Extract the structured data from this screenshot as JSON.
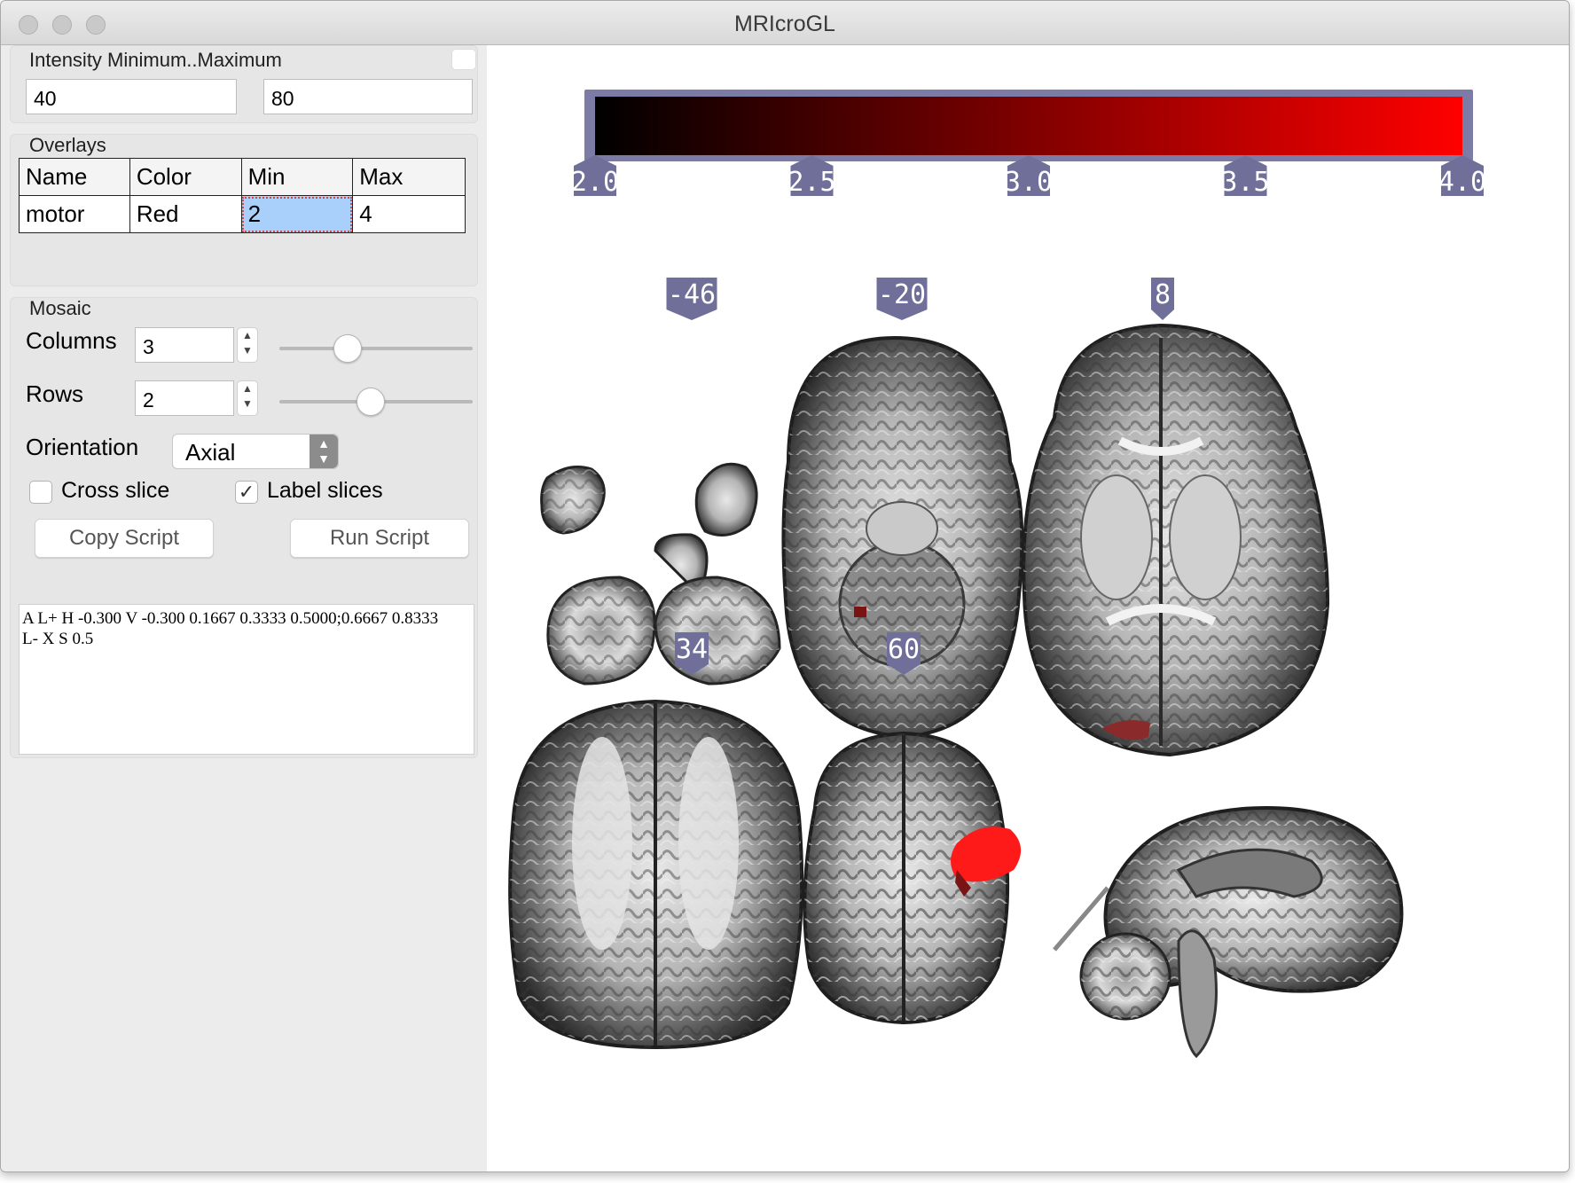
{
  "window": {
    "title": "MRIcroGL"
  },
  "intensity": {
    "label": "Intensity Minimum..Maximum",
    "min": "40",
    "max": "80"
  },
  "overlays": {
    "label": "Overlays",
    "headers": {
      "name": "Name",
      "color": "Color",
      "min": "Min",
      "max": "Max"
    },
    "row": {
      "name": "motor",
      "color": "Red",
      "min": "2",
      "max": "4"
    }
  },
  "mosaic": {
    "label": "Mosaic",
    "columns_label": "Columns",
    "columns_value": "3",
    "columns_slider_fraction": 0.33,
    "rows_label": "Rows",
    "rows_value": "2",
    "rows_slider_fraction": 0.47,
    "orientation_label": "Orientation",
    "orientation_value": "Axial",
    "cross_slice_label": "Cross slice",
    "cross_slice_checked": false,
    "label_slices_label": "Label slices",
    "label_slices_checked": true,
    "copy_button": "Copy Script",
    "run_button": "Run Script",
    "script_line1": "A L+ H -0.300 V -0.300 0.1667 0.3333 0.5000;0.6667 0.8333",
    "script_line2": "L- X S 0.5"
  },
  "colorbar": {
    "colormap": "black-to-red",
    "color_low": "#000000",
    "color_high": "#ff0000",
    "frame_color": "#7b7ba6",
    "ticks": [
      "2.0",
      "2.5",
      "3.0",
      "3.5",
      "4.0"
    ]
  },
  "slice_labels": {
    "top": [
      "-46",
      "-20",
      "8"
    ],
    "bottom": [
      "34",
      "60"
    ]
  },
  "accent": {
    "overlay_red": "#ff1a1a",
    "label_bg": "#6f6f9a"
  }
}
